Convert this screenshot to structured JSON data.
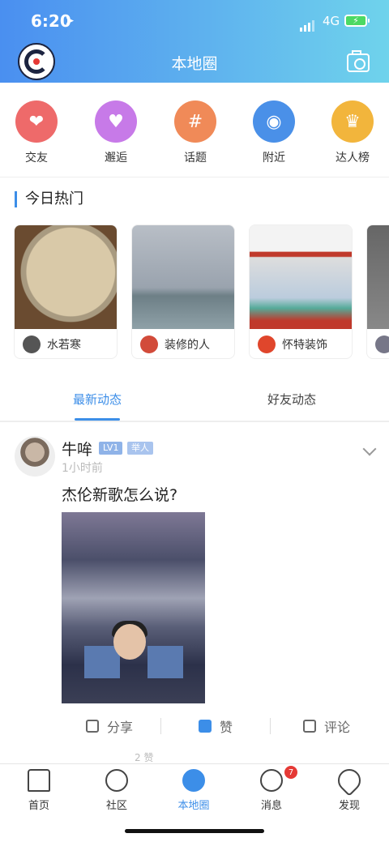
{
  "status": {
    "time": "6:20",
    "network": "4G"
  },
  "header": {
    "title": "本地圈"
  },
  "categories": [
    {
      "label": "交友",
      "icon": "heart-chat-icon",
      "color": "#ee6a6a"
    },
    {
      "label": "邂逅",
      "icon": "heartbeat-icon",
      "color": "#c77ae8"
    },
    {
      "label": "话题",
      "icon": "hashtag-icon",
      "color": "#f08a58"
    },
    {
      "label": "附近",
      "icon": "location-pin-icon",
      "color": "#4a90e8"
    },
    {
      "label": "达人榜",
      "icon": "crown-icon",
      "color": "#f2b53c"
    }
  ],
  "hot": {
    "title": "今日热门",
    "cards": [
      {
        "name": "水若寒"
      },
      {
        "name": "装修的人"
      },
      {
        "name": "怀特装饰"
      },
      {
        "name": ""
      }
    ]
  },
  "tabs": [
    {
      "label": "最新动态"
    },
    {
      "label": "好友动态"
    }
  ],
  "post": {
    "author": "牛哞",
    "level": "LV1",
    "role": "举人",
    "time": "1小时前",
    "text": "杰伦新歌怎么说?",
    "actions": {
      "share": "分享",
      "like": "赞",
      "comment": "评论"
    },
    "peek_text": "2 赞"
  },
  "tabbar": {
    "items": [
      {
        "label": "首页"
      },
      {
        "label": "社区"
      },
      {
        "label": "本地圈"
      },
      {
        "label": "消息",
        "badge": "7"
      },
      {
        "label": "发现"
      }
    ]
  },
  "colors": {
    "accent": "#3c8ee8",
    "header_start": "#4a8ff0",
    "header_end": "#6fd3ec"
  }
}
